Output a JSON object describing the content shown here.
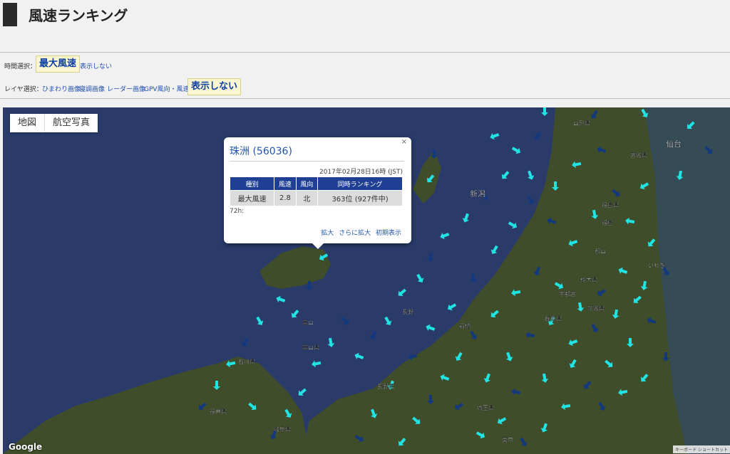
{
  "header": {
    "title": "風速ランキング"
  },
  "time_select": {
    "label": "時間選択：",
    "selected": "最大風速",
    "hide": "表示しない"
  },
  "layer_select": {
    "label": "レイヤ選択：",
    "options": [
      "ひまわり画像",
      "寝調画像",
      "レーダー画像",
      "GPV風向・風速"
    ],
    "selected": "表示しない"
  },
  "map": {
    "type_buttons": [
      "地図",
      "航空写真"
    ],
    "google_label": "Google",
    "shortcut_label": "キーボード ショートカット",
    "land_color": "#3f4d2a",
    "sea_color": "#2a3b6a",
    "arrow_cyan": "#22e3e3",
    "arrow_navy": "#14387e",
    "place_labels": [
      "新潟",
      "仙台",
      "福島県",
      "福島",
      "群馬県",
      "栃木県",
      "茨城県",
      "宇都宮",
      "前橋",
      "長野",
      "富山",
      "富山県",
      "石川県",
      "福井県",
      "岐阜県",
      "東京",
      "いわき",
      "山形県",
      "宮城県",
      "郡山",
      "埼玉県",
      "長野県"
    ]
  },
  "popup": {
    "title": "珠洲 (56036)",
    "close": "×",
    "datetime": "2017年02月28日16時 (JST)",
    "table": {
      "headers": [
        "種別",
        "風速",
        "風向",
        "同時ランキング"
      ],
      "row": [
        "最大風速",
        "2.8",
        "北",
        "363位 (927件中)"
      ]
    },
    "h72_label": "72h:",
    "links": [
      "拡大",
      "さらに拡大",
      "初期表示"
    ]
  }
}
